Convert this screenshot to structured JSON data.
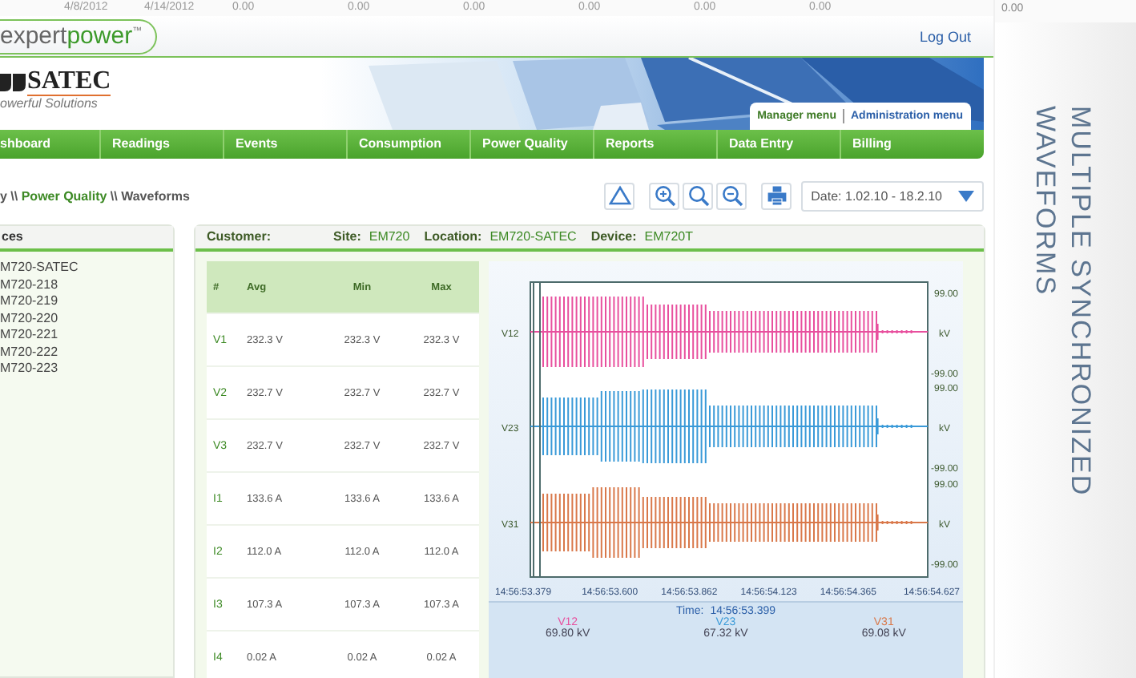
{
  "background_row": {
    "cells": [
      "4/8/2012",
      "4/14/2012",
      "0.00",
      "0.00",
      "0.00",
      "0.00",
      "0.00",
      "0.00"
    ]
  },
  "header": {
    "logo": {
      "prefix": "expert",
      "accent": "power",
      "mark": "™"
    },
    "logout": "Log Out"
  },
  "brand": {
    "name": "SATEC",
    "tagline": "owerful Solutions"
  },
  "menu_tabs": [
    {
      "label": "Manager menu",
      "selected": true
    },
    {
      "label": "Administration menu",
      "selected": false
    }
  ],
  "nav": [
    "shboard",
    "Readings",
    "Events",
    "Consumption",
    "Power Quality",
    "Reports",
    "Data Entry",
    "Billing"
  ],
  "breadcrumb": "y \\\\ **Power Quality** \\\\ Waveforms",
  "date_picker": {
    "label": "Date: 1.02.10 - 18.2.10"
  },
  "devices": {
    "title": "ces",
    "items": [
      "M720-SATEC",
      "M720-218",
      "M720-219",
      "M720-220",
      "M720-221",
      "M720-222",
      "M720-223"
    ]
  },
  "info": [
    {
      "label": "Customer:"
    },
    {
      "label": "Site:",
      "value": "EM720"
    },
    {
      "label": "Location:",
      "value": "EM720-SATEC"
    },
    {
      "label": "Device:",
      "value": "EM720T"
    }
  ],
  "table": {
    "columns": [
      "#",
      "Avg",
      "Min",
      "Max"
    ],
    "rows": [
      [
        "V1",
        "232.3 V",
        "232.3 V",
        "232.3 V"
      ],
      [
        "V2",
        "232.7 V",
        "232.7 V",
        "232.7 V"
      ],
      [
        "V3",
        "232.7 V",
        "232.7 V",
        "232.7 V"
      ],
      [
        "I1",
        "133.6 A",
        "133.6 A",
        "133.6 A"
      ],
      [
        "I2",
        "112.0 A",
        "112.0 A",
        "112.0 A"
      ],
      [
        "I3",
        "107.3 A",
        "107.3 A",
        "107.3 A"
      ],
      [
        "I4",
        "0.02 A",
        "0.02 A",
        "0.02 A"
      ]
    ]
  },
  "waveforms": {
    "traces": [
      {
        "name": "V12",
        "color": "#e8509e",
        "max": "99.00",
        "unit": "kV",
        "min": "-99.00"
      },
      {
        "name": "V23",
        "color": "#3a9ad8",
        "max": "99.00",
        "unit": "kV",
        "min": "-99.00"
      },
      {
        "name": "V31",
        "color": "#d9784a",
        "max": "99.00",
        "unit": "kV",
        "min": "-99.00"
      }
    ],
    "time_ticks": [
      "14:56:53.379",
      "14:56:53.600",
      "14:56:53.862",
      "14:56:54.123",
      "14:56:54.365",
      "14:56:54.627"
    ],
    "cursor": {
      "label": "Time:",
      "value": "14:56:53.399"
    },
    "readings": [
      {
        "name": "V12",
        "value": "69.80 kV"
      },
      {
        "name": "V23",
        "value": "67.32 kV"
      },
      {
        "name": "V31",
        "value": "69.08 kV"
      }
    ]
  },
  "side": {
    "value": "0.00",
    "caption": [
      "MULTIPLE SYNCHRONIZED",
      "WAVEFORMS"
    ]
  }
}
